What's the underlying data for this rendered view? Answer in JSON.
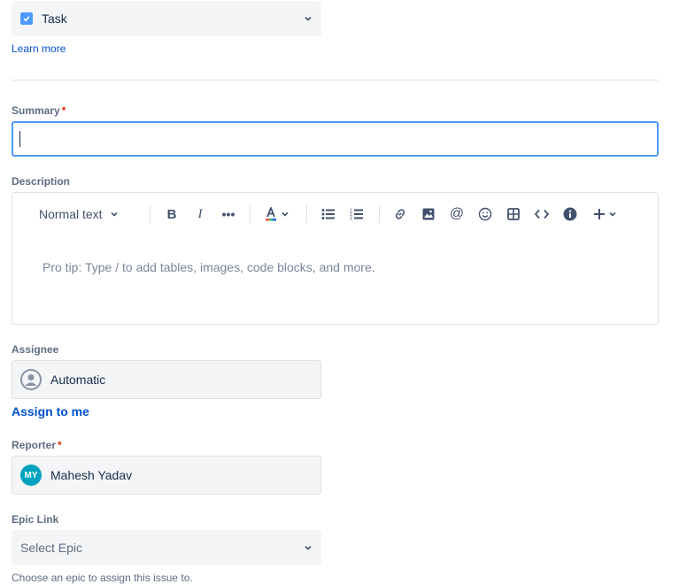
{
  "issue_type": {
    "value": "Task",
    "learn_more": "Learn more"
  },
  "summary": {
    "label": "Summary",
    "required": "*",
    "value": ""
  },
  "description": {
    "label": "Description",
    "toolbar": {
      "text_style": "Normal text"
    },
    "placeholder": "Pro tip: Type / to add tables, images, code blocks, and more."
  },
  "assignee": {
    "label": "Assignee",
    "value": "Automatic",
    "assign_to_me": "Assign to me"
  },
  "reporter": {
    "label": "Reporter",
    "required": "*",
    "value": "Mahesh Yadav",
    "initials": "MY"
  },
  "epic_link": {
    "label": "Epic Link",
    "placeholder": "Select Epic",
    "help": "Choose an epic to assign this issue to."
  },
  "colors": {
    "link": "#0052cc",
    "focus": "#4c9aff",
    "required": "#de350b",
    "checkbox": "#4c9aff",
    "avatar": "#00a3bf"
  }
}
